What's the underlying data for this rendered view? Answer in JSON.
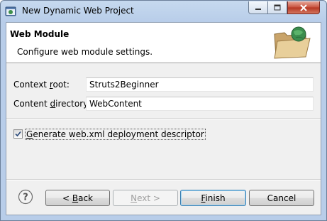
{
  "window": {
    "title": "New Dynamic Web Project",
    "icon": "eclipse-web-project-icon"
  },
  "banner": {
    "title": "Web Module",
    "description": "Configure web module settings.",
    "icon": "folder-globe-icon"
  },
  "form": {
    "context_root_label": "Context root:",
    "context_root_value": "Struts2Beginner",
    "content_directory_label": "Content directory:",
    "content_directory_value": "WebContent",
    "generate_xml_label": "Generate web.xml deployment descriptor",
    "generate_xml_checked": true
  },
  "buttons": {
    "back": "< Back",
    "next": "Next >",
    "finish": "Finish",
    "cancel": "Cancel"
  }
}
